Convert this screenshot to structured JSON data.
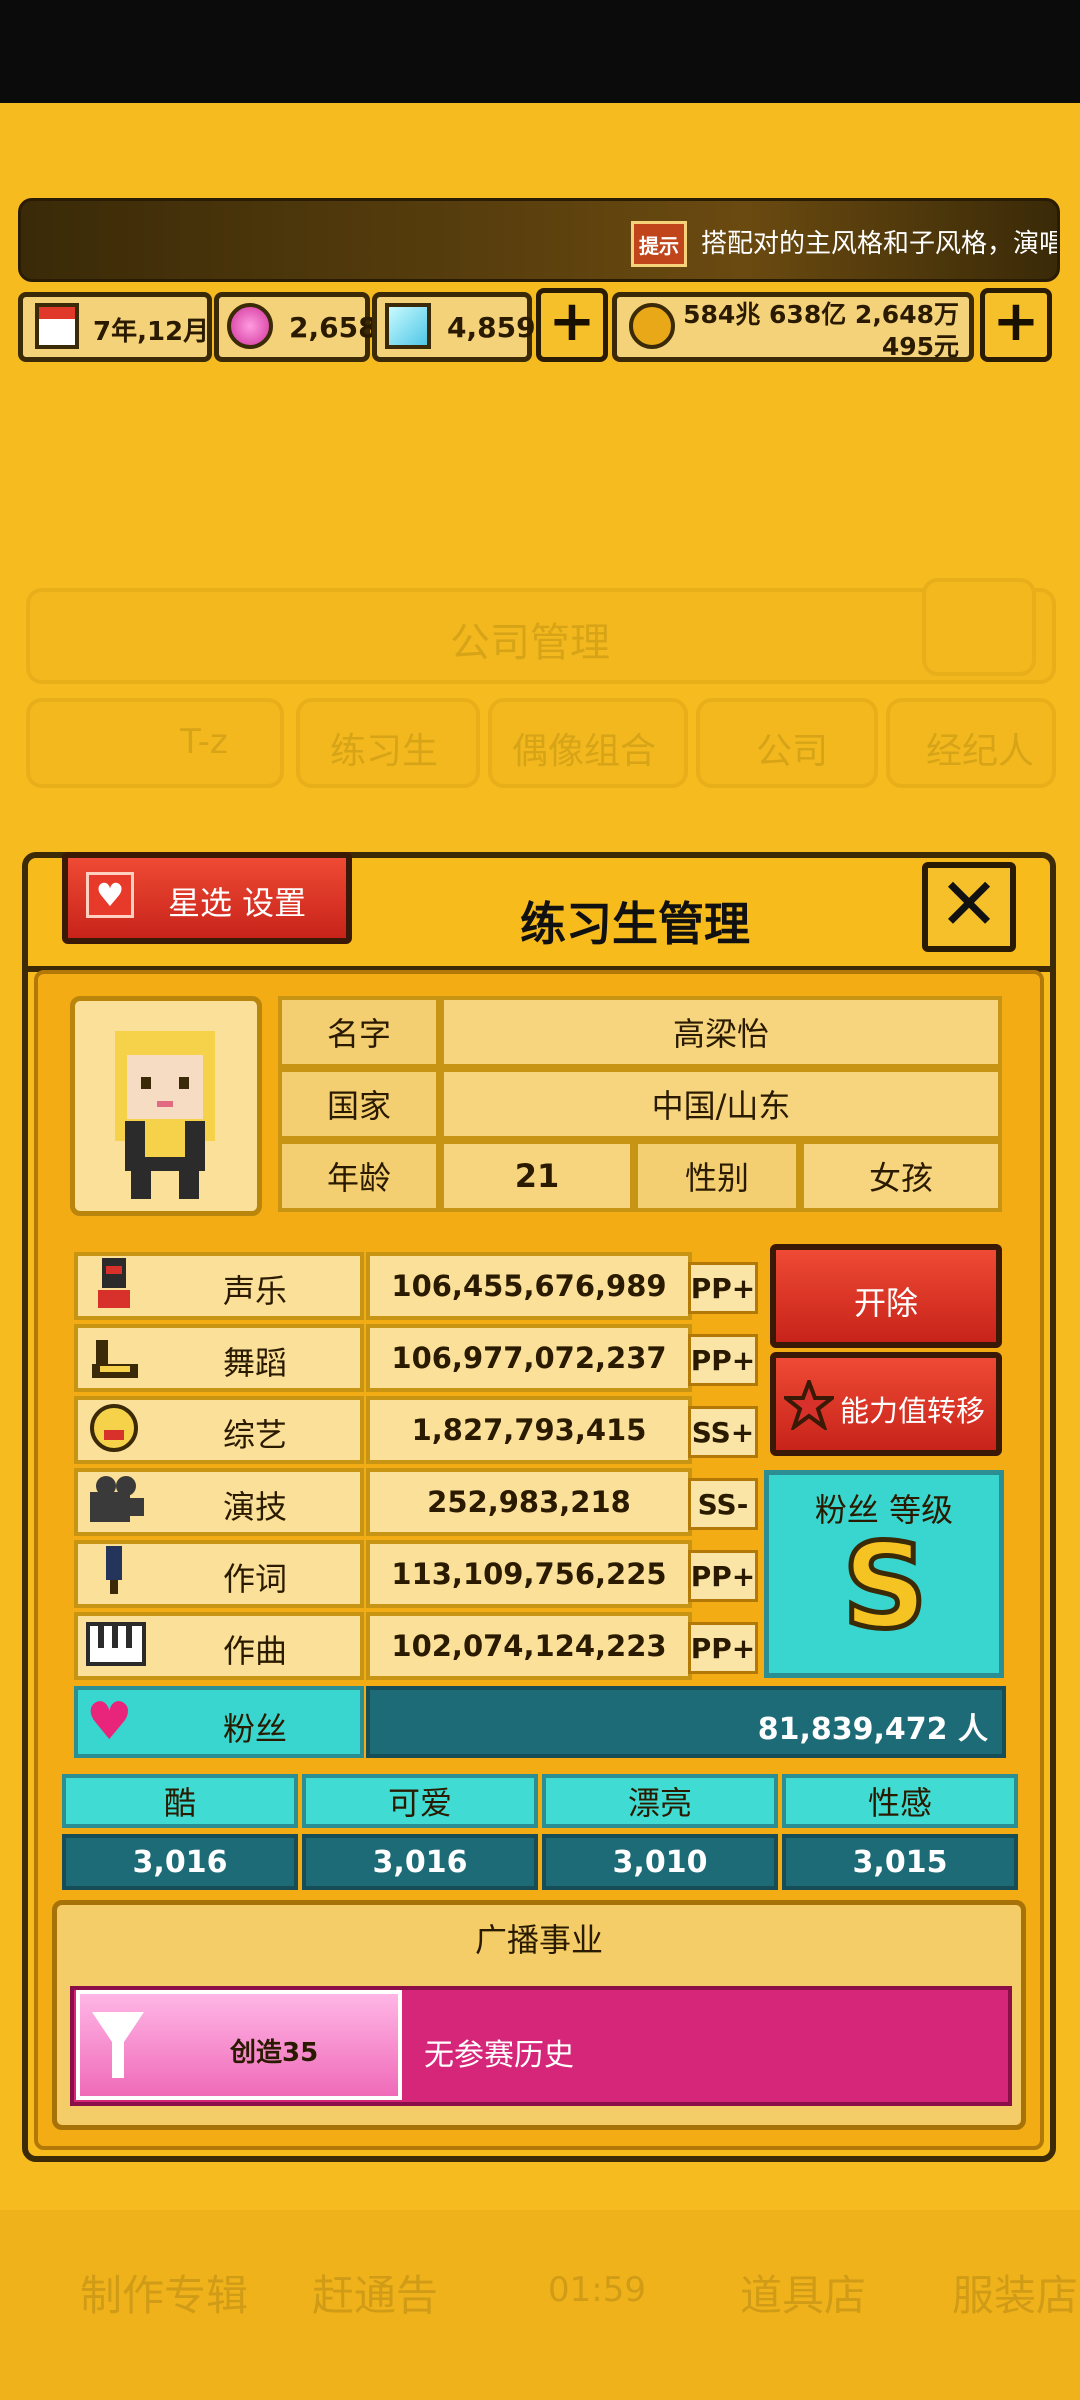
{
  "tip": {
    "badge": "提示",
    "text": "搭配对的主风格和子风格，演唱会"
  },
  "resources": {
    "date": "7年,12月",
    "gems": "2,658",
    "diamonds": "4,859",
    "money_line1": "584兆 638亿 2,648万",
    "money_line2": "495元",
    "plus": "+"
  },
  "background_ui": {
    "title": "公司管理",
    "tabs": [
      "T-z",
      "练习生",
      "偶像组合",
      "公司",
      "经纪人"
    ]
  },
  "dialog": {
    "title": "练习生管理",
    "star_button": "星选 设置",
    "close": "✕"
  },
  "profile": {
    "name_label": "名字",
    "name": "高梁怡",
    "country_label": "国家",
    "country": "中国/山东",
    "age_label": "年龄",
    "age": "21",
    "gender_label": "性别",
    "gender": "女孩"
  },
  "stats": [
    {
      "name": "声乐",
      "value": "106,455,676,989",
      "grade": "PP+"
    },
    {
      "name": "舞蹈",
      "value": "106,977,072,237",
      "grade": "PP+"
    },
    {
      "name": "综艺",
      "value": "1,827,793,415",
      "grade": "SS+"
    },
    {
      "name": "演技",
      "value": "252,983,218",
      "grade": "SS-"
    },
    {
      "name": "作词",
      "value": "113,109,756,225",
      "grade": "PP+"
    },
    {
      "name": "作曲",
      "value": "102,074,124,223",
      "grade": "PP+"
    }
  ],
  "fans": {
    "label": "粉丝",
    "value": "81,839,472 人"
  },
  "actions": {
    "dismiss": "开除",
    "transfer": "能力值转移"
  },
  "fan_level": {
    "label": "粉丝 等级",
    "grade": "S"
  },
  "attributes": [
    {
      "name": "酷",
      "value": "3,016"
    },
    {
      "name": "可爱",
      "value": "3,016"
    },
    {
      "name": "漂亮",
      "value": "3,010"
    },
    {
      "name": "性感",
      "value": "3,015"
    }
  ],
  "broadcast": {
    "title": "广播事业",
    "program": "创造35",
    "history": "无参赛历史"
  },
  "bottom_nav": [
    "制作专辑",
    "赶通告",
    "01:59",
    "道具店",
    "服装店"
  ],
  "colors": {
    "background": "#f6bb1e",
    "cyan": "#40dcd3",
    "teal": "#1e6b78",
    "red": "#d8302a",
    "magenta": "#d6267a"
  }
}
